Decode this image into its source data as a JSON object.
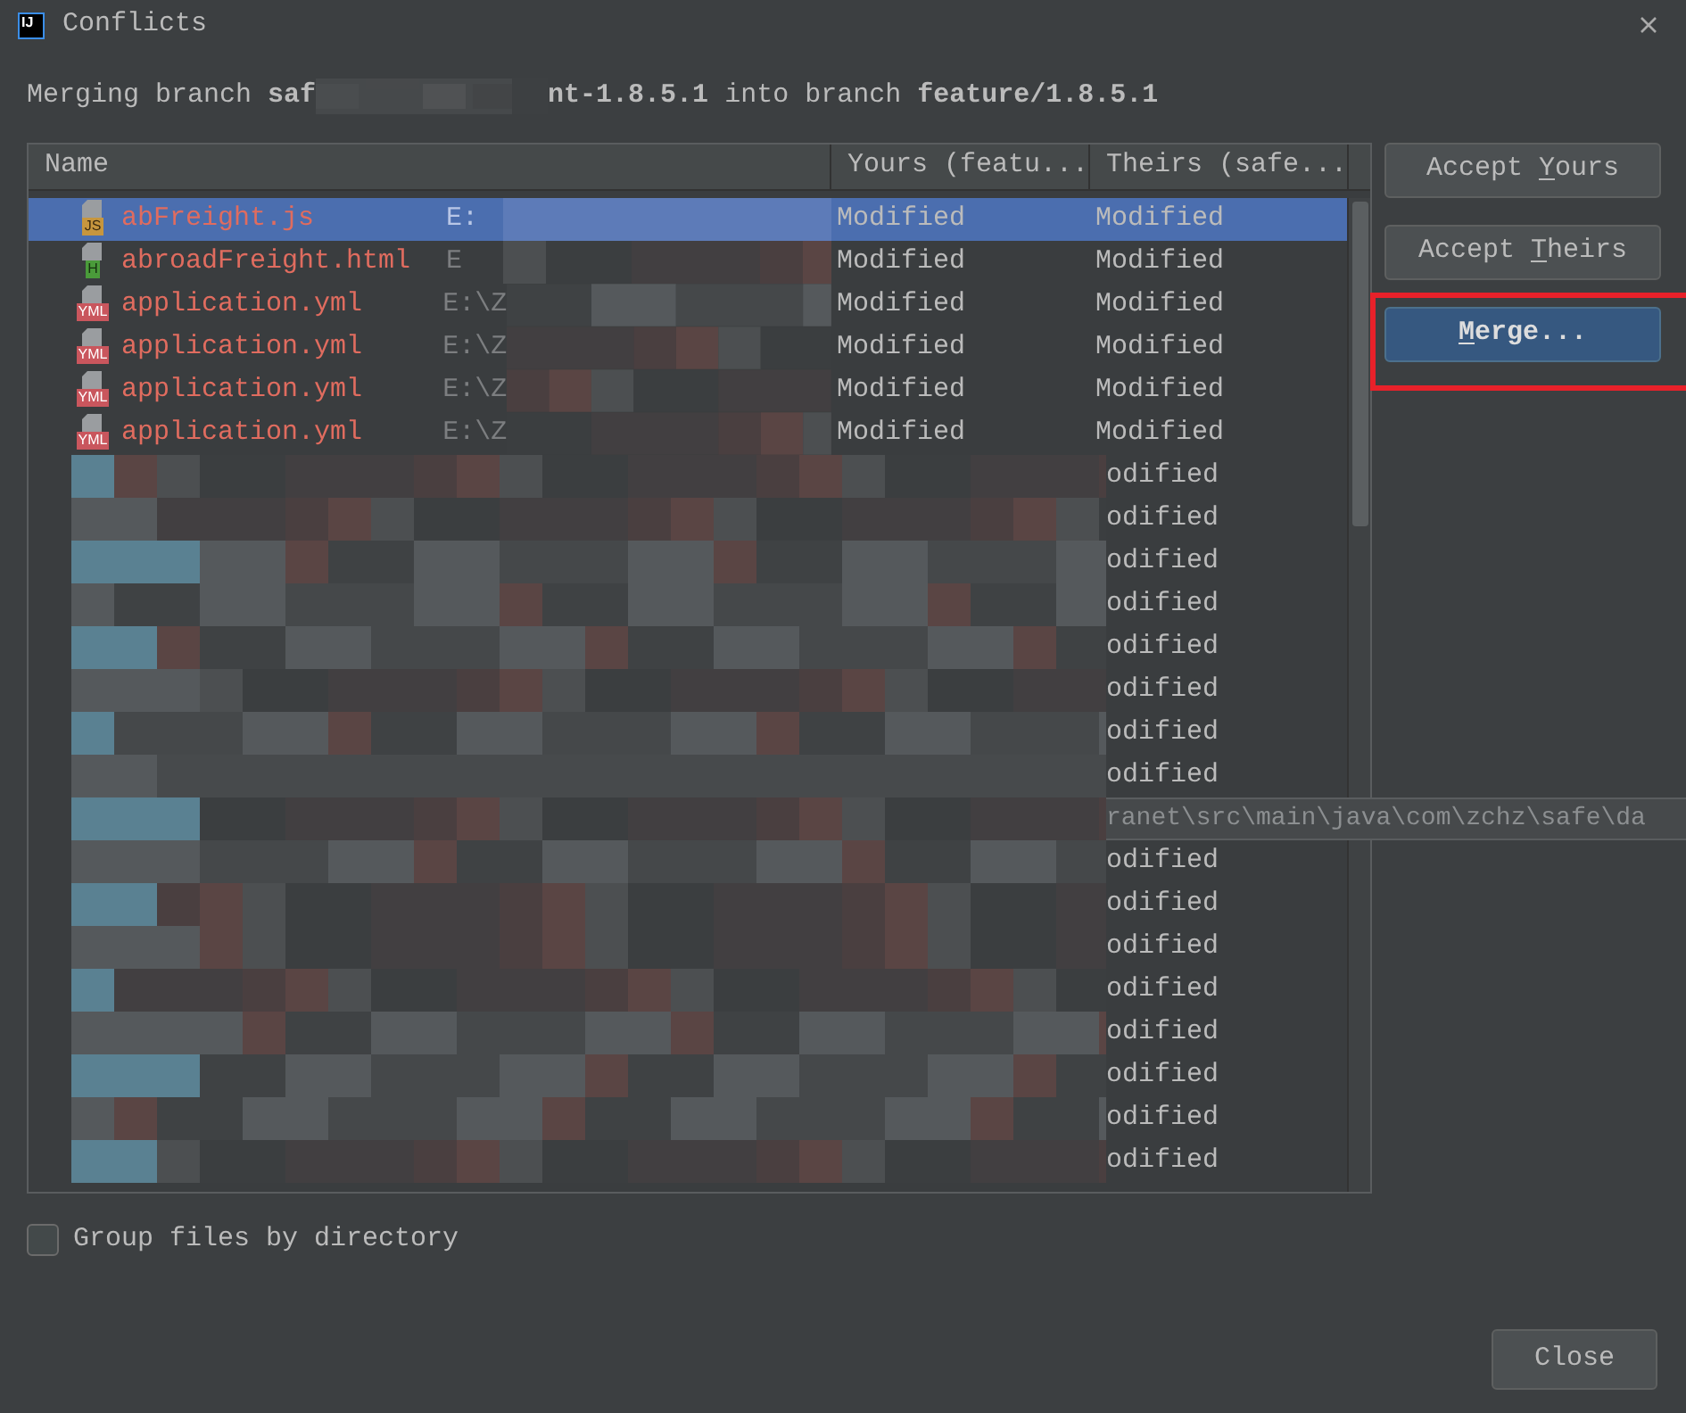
{
  "window": {
    "title": "Conflicts",
    "app_icon_text": "IJ"
  },
  "message": {
    "before": "Merging branch **saf**",
    "after": "**nt-1.8.5.1** into branch **feature/1.8.5.1**"
  },
  "table": {
    "columns": [
      "Name",
      "Yours (featu...",
      "Theirs (safe..."
    ],
    "rows": [
      {
        "name": "abFreight.js",
        "badge": "JS",
        "kind": "js",
        "path": "E:",
        "yours": "Modified",
        "theirs": "Modified",
        "selected": true
      },
      {
        "name": "abroadFreight.html",
        "badge": "H",
        "kind": "html",
        "path": "E",
        "yours": "Modified",
        "theirs": "Modified",
        "selected": false
      },
      {
        "name": "application.yml",
        "badge": "YML",
        "kind": "yml",
        "path": "E:\\Z",
        "yours": "Modified",
        "theirs": "Modified",
        "selected": false
      },
      {
        "name": "application.yml",
        "badge": "YML",
        "kind": "yml",
        "path": "E:\\Z",
        "yours": "Modified",
        "theirs": "Modified",
        "selected": false
      },
      {
        "name": "application.yml",
        "badge": "YML",
        "kind": "yml",
        "path": "E:\\Z",
        "yours": "Modified",
        "theirs": "Modified",
        "selected": false
      },
      {
        "name": "application.yml",
        "badge": "YML",
        "kind": "yml",
        "path": "E:\\Z",
        "yours": "Modified",
        "theirs": "Modified",
        "selected": false
      },
      {
        "theirs": "odified",
        "selected": false
      },
      {
        "theirs": "odified",
        "selected": false
      },
      {
        "theirs": "odified",
        "selected": false
      },
      {
        "theirs": "odified",
        "selected": false
      },
      {
        "theirs": "odified",
        "selected": false
      },
      {
        "theirs": "odified",
        "selected": false
      },
      {
        "theirs": "odified",
        "selected": false
      },
      {
        "theirs": "odified",
        "selected": false
      },
      {
        "tooltip": "ranet\\src\\main\\java\\com\\zchz\\safe\\da",
        "selected": false
      },
      {
        "theirs": "odified",
        "selected": false
      },
      {
        "theirs": "odified",
        "selected": false
      },
      {
        "theirs": "odified",
        "selected": false
      },
      {
        "theirs": "odified",
        "selected": false
      },
      {
        "theirs": "odified",
        "selected": false
      },
      {
        "theirs": "odified",
        "selected": false
      },
      {
        "theirs": "odified",
        "selected": false
      },
      {
        "theirs": "odified",
        "selected": false
      }
    ]
  },
  "buttons": [
    {
      "before": "Accept ",
      "mnemonic": "Y",
      "after": "ours",
      "default": false
    },
    {
      "before": "Accept ",
      "mnemonic": "T",
      "after": "heirs",
      "default": false
    },
    {
      "mnemonic": "M",
      "after": "erge...",
      "default": true
    }
  ],
  "checkbox": {
    "label": "Group files by directory",
    "checked": false
  },
  "close_button": {
    "label": "Close"
  }
}
